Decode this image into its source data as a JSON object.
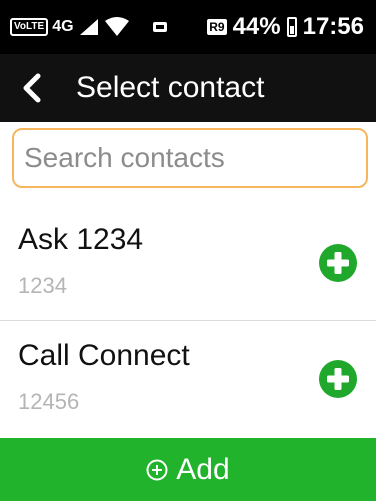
{
  "status_bar": {
    "volte": "VoLTE",
    "network": "4G",
    "sim": "R9",
    "battery_percent": "44%",
    "time": "17:56"
  },
  "header": {
    "title": "Select contact"
  },
  "search": {
    "placeholder": "Search contacts"
  },
  "contacts": [
    {
      "name": "Ask 1234",
      "number": "1234"
    },
    {
      "name": "Call Connect",
      "number": "12456"
    }
  ],
  "footer": {
    "add_label": "Add"
  },
  "colors": {
    "accent_green": "#22b32c",
    "search_border": "#f6b65e"
  }
}
